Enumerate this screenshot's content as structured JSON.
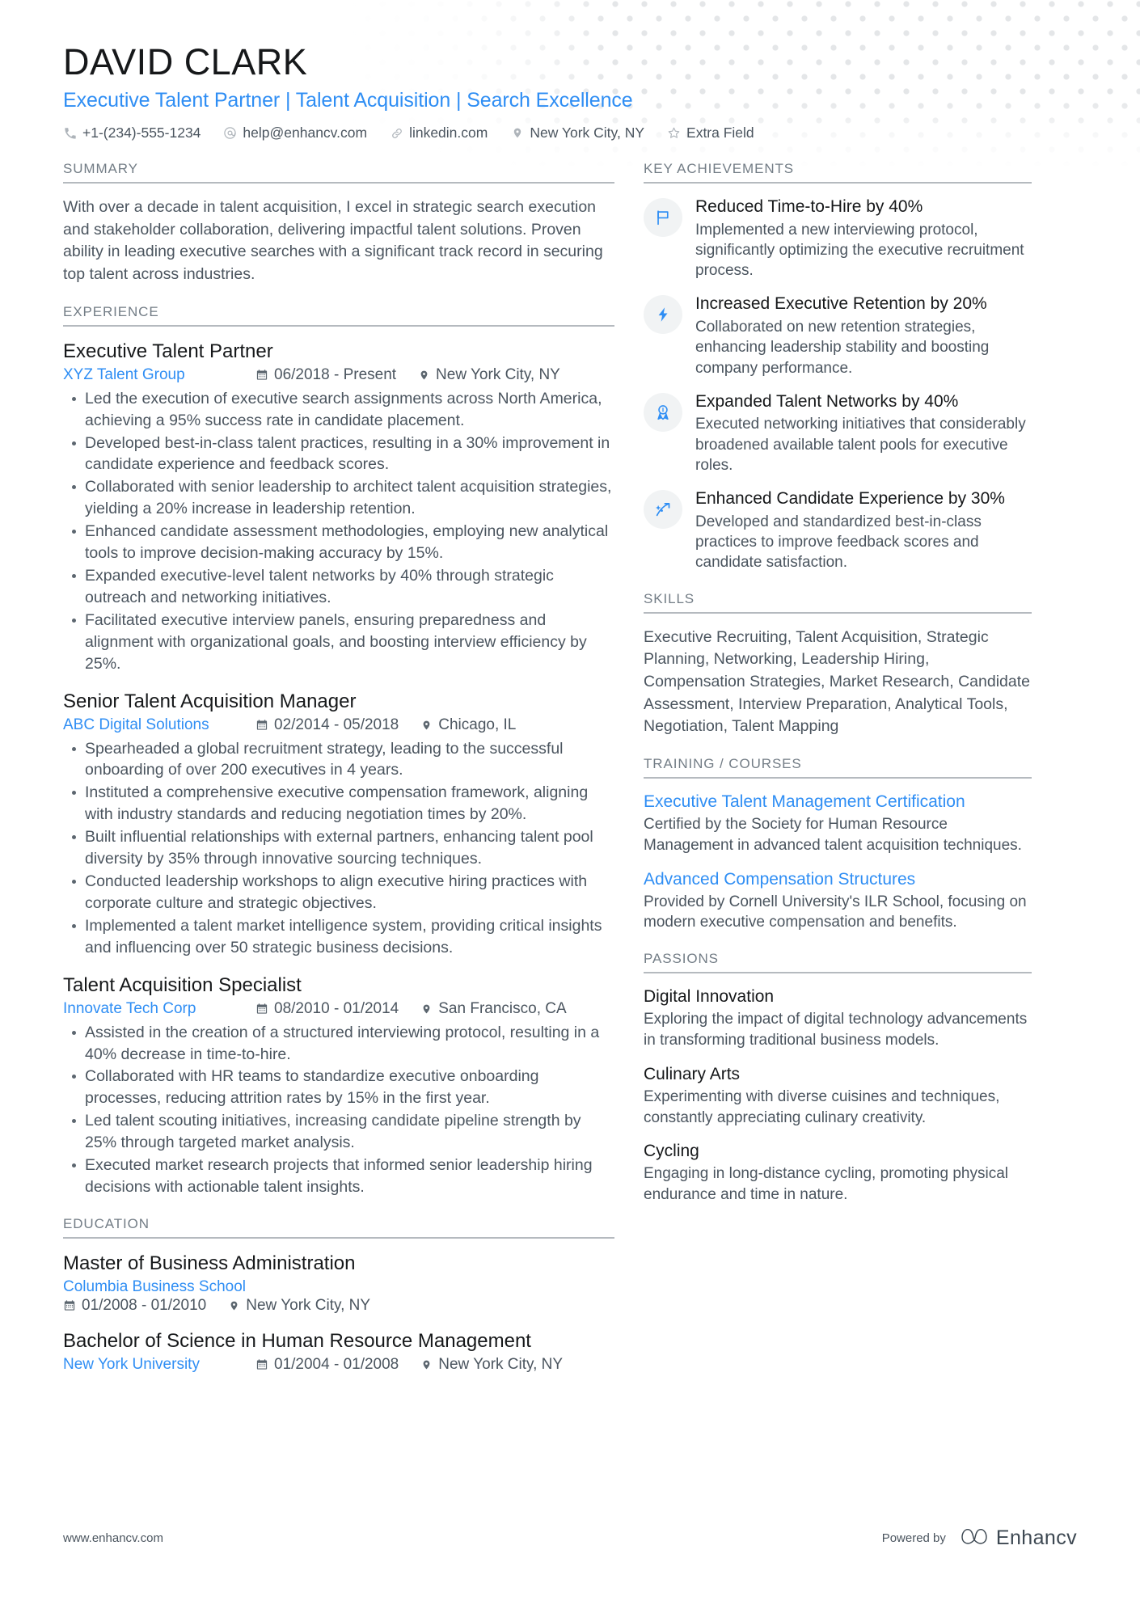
{
  "header": {
    "name": "DAVID CLARK",
    "headline": "Executive Talent Partner | Talent Acquisition | Search Excellence",
    "contacts": [
      {
        "icon": "phone-icon",
        "text": "+1-(234)-555-1234"
      },
      {
        "icon": "email-icon",
        "text": "help@enhancv.com"
      },
      {
        "icon": "link-icon",
        "text": "linkedin.com"
      },
      {
        "icon": "location-pin-icon",
        "text": "New York City, NY"
      },
      {
        "icon": "star-icon",
        "text": "Extra Field"
      }
    ]
  },
  "summary": {
    "title": "SUMMARY",
    "text": "With over a decade in talent acquisition, I excel in strategic search execution and stakeholder collaboration, delivering impactful talent solutions. Proven ability in leading executive searches with a significant track record in securing top talent across industries."
  },
  "experience": {
    "title": "EXPERIENCE",
    "entries": [
      {
        "role": "Executive Talent Partner",
        "company": "XYZ Talent Group",
        "dates": "06/2018 - Present",
        "location": "New York City, NY",
        "bullets": [
          "Led the execution of executive search assignments across North America, achieving a 95% success rate in candidate placement.",
          "Developed best-in-class talent practices, resulting in a 30% improvement in candidate experience and feedback scores.",
          "Collaborated with senior leadership to architect talent acquisition strategies, yielding a 20% increase in leadership retention.",
          "Enhanced candidate assessment methodologies, employing new analytical tools to improve decision-making accuracy by 15%.",
          "Expanded executive-level talent networks by 40% through strategic outreach and networking initiatives.",
          "Facilitated executive interview panels, ensuring preparedness and alignment with organizational goals, and boosting interview efficiency by 25%."
        ]
      },
      {
        "role": "Senior Talent Acquisition Manager",
        "company": "ABC Digital Solutions",
        "dates": "02/2014 - 05/2018",
        "location": "Chicago, IL",
        "bullets": [
          "Spearheaded a global recruitment strategy, leading to the successful onboarding of over 200 executives in 4 years.",
          "Instituted a comprehensive executive compensation framework, aligning with industry standards and reducing negotiation times by 20%.",
          "Built influential relationships with external partners, enhancing talent pool diversity by 35% through innovative sourcing techniques.",
          "Conducted leadership workshops to align executive hiring practices with corporate culture and strategic objectives.",
          "Implemented a talent market intelligence system, providing critical insights and influencing over 50 strategic business decisions."
        ]
      },
      {
        "role": "Talent Acquisition Specialist",
        "company": "Innovate Tech Corp",
        "dates": "08/2010 - 01/2014",
        "location": "San Francisco, CA",
        "bullets": [
          "Assisted in the creation of a structured interviewing protocol, resulting in a 40% decrease in time-to-hire.",
          "Collaborated with HR teams to standardize executive onboarding processes, reducing attrition rates by 15% in the first year.",
          "Led talent scouting initiatives, increasing candidate pipeline strength by 25% through targeted market analysis.",
          "Executed market research projects that informed senior leadership hiring decisions with actionable talent insights."
        ]
      }
    ]
  },
  "education": {
    "title": "EDUCATION",
    "entries": [
      {
        "degree": "Master of Business Administration",
        "school": "Columbia Business School",
        "dates": "01/2008 - 01/2010",
        "location": "New York City, NY",
        "stacked": true
      },
      {
        "degree": "Bachelor of Science in Human Resource Management",
        "school": "New York University",
        "dates": "01/2004 - 01/2008",
        "location": "New York City, NY",
        "stacked": false
      }
    ]
  },
  "key_achievements": {
    "title": "KEY ACHIEVEMENTS",
    "items": [
      {
        "icon": "flag-icon",
        "title": "Reduced Time-to-Hire by 40%",
        "desc": "Implemented a new interviewing protocol, significantly optimizing the executive recruitment process."
      },
      {
        "icon": "lightning-bolt-icon",
        "title": "Increased Executive Retention by 20%",
        "desc": "Collaborated on new retention strategies, enhancing leadership stability and boosting company performance."
      },
      {
        "icon": "award-ribbon-icon",
        "title": "Expanded Talent Networks by 40%",
        "desc": "Executed networking initiatives that considerably broadened available talent pools for executive roles."
      },
      {
        "icon": "growth-arrow-icon",
        "title": "Enhanced Candidate Experience by 30%",
        "desc": "Developed and standardized best-in-class practices to improve feedback scores and candidate satisfaction."
      }
    ]
  },
  "skills": {
    "title": "SKILLS",
    "text": "Executive Recruiting, Talent Acquisition, Strategic Planning, Networking, Leadership Hiring, Compensation Strategies, Market Research, Candidate Assessment, Interview Preparation, Analytical Tools, Negotiation, Talent Mapping"
  },
  "training": {
    "title": "TRAINING / COURSES",
    "items": [
      {
        "name": "Executive Talent Management Certification",
        "desc": "Certified by the Society for Human Resource Management in advanced talent acquisition techniques."
      },
      {
        "name": "Advanced Compensation Structures",
        "desc": "Provided by Cornell University's ILR School, focusing on modern executive compensation and benefits."
      }
    ]
  },
  "passions": {
    "title": "PASSIONS",
    "items": [
      {
        "name": "Digital Innovation",
        "desc": "Exploring the impact of digital technology advancements in transforming traditional business models."
      },
      {
        "name": "Culinary Arts",
        "desc": "Experimenting with diverse cuisines and techniques, constantly appreciating culinary creativity."
      },
      {
        "name": "Cycling",
        "desc": "Engaging in long-distance cycling, promoting physical endurance and time in nature."
      }
    ]
  },
  "footer": {
    "url": "www.enhancv.com",
    "powered_by": "Powered by",
    "brand": "Enhancv"
  },
  "colors": {
    "accent": "#2f8ef4",
    "heading": "#16181a",
    "body": "#4b555f",
    "muted": "#737d86",
    "rule": "#b5babf",
    "badge_bg": "#f1f3f4"
  }
}
